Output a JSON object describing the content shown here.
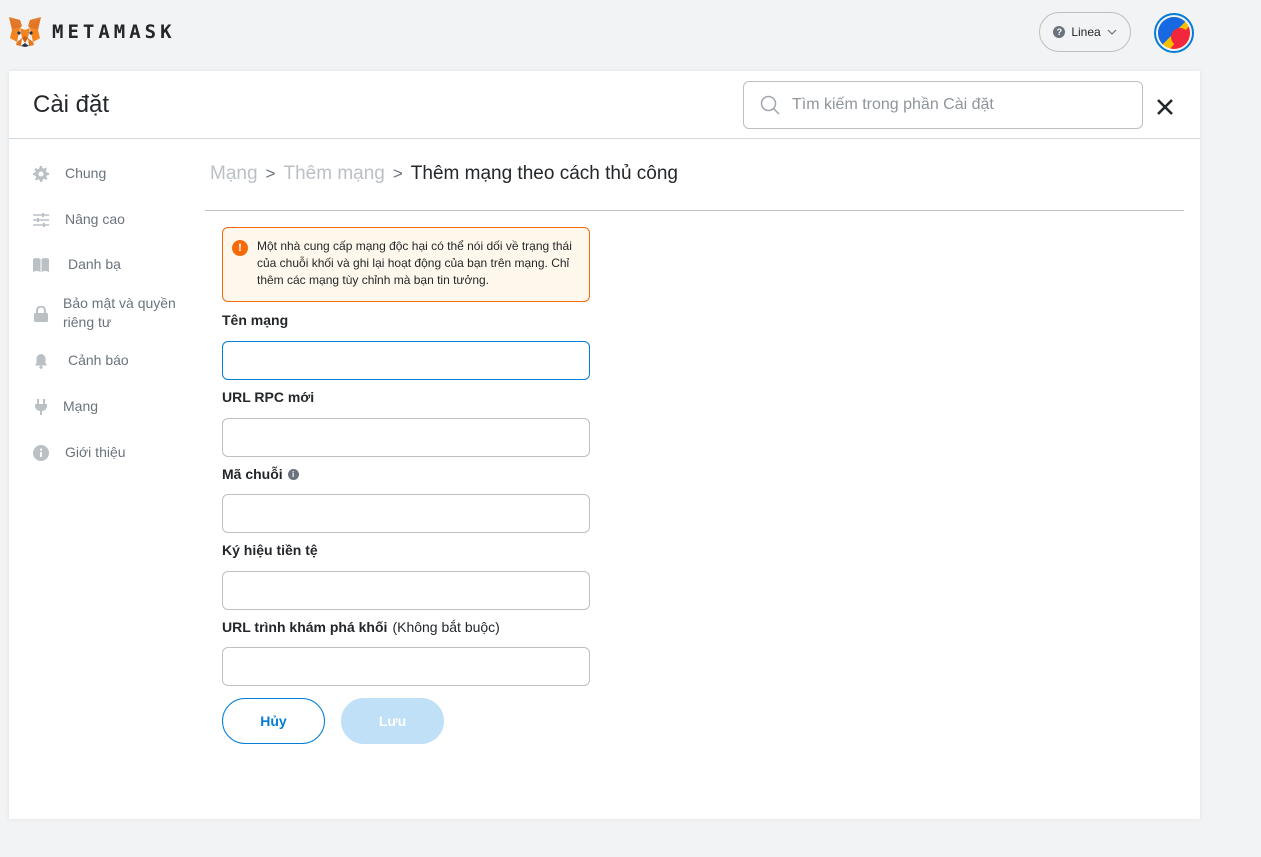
{
  "app": {
    "logo_text": "METAMASK"
  },
  "topbar": {
    "network_label": "Linea"
  },
  "header": {
    "title": "Cài đặt",
    "search_placeholder": "Tìm kiếm trong phần Cài đặt"
  },
  "sidebar": {
    "items": [
      {
        "label": "Chung",
        "icon": "gear-icon"
      },
      {
        "label": "Nâng cao",
        "icon": "sliders-icon"
      },
      {
        "label": "Danh bạ",
        "icon": "book-icon"
      },
      {
        "label": "Bảo mật và quyền riêng tư",
        "icon": "lock-icon"
      },
      {
        "label": "Cảnh báo",
        "icon": "bell-icon"
      },
      {
        "label": "Mạng",
        "icon": "plug-icon"
      },
      {
        "label": "Giới thiệu",
        "icon": "info-icon"
      }
    ]
  },
  "breadcrumb": {
    "items": [
      "Mạng",
      "Thêm mạng"
    ],
    "separator": ">",
    "current": "Thêm mạng theo cách thủ công"
  },
  "warning": {
    "text": "Một nhà cung cấp mạng độc hại có thể nói dối về trạng thái của chuỗi khối và ghi lại hoạt động của bạn trên mạng. Chỉ thêm các mạng tùy chỉnh mà bạn tin tưởng."
  },
  "form": {
    "network_name_label": "Tên mạng",
    "network_name_value": "",
    "rpc_url_label": "URL RPC mới",
    "rpc_url_value": "",
    "chain_id_label": "Mã chuỗi",
    "chain_id_value": "",
    "currency_symbol_label": "Ký hiệu tiền tệ",
    "currency_symbol_value": "",
    "block_explorer_label": "URL trình khám phá khối",
    "block_explorer_optional": "(Không bắt buộc)",
    "block_explorer_value": ""
  },
  "buttons": {
    "cancel": "Hủy",
    "save": "Lưu"
  },
  "colors": {
    "primary": "#037dd6",
    "warning_border": "#f66a0a",
    "warning_bg": "#fef8ec",
    "muted": "#6a737d",
    "save_disabled": "#bfe0f7"
  }
}
